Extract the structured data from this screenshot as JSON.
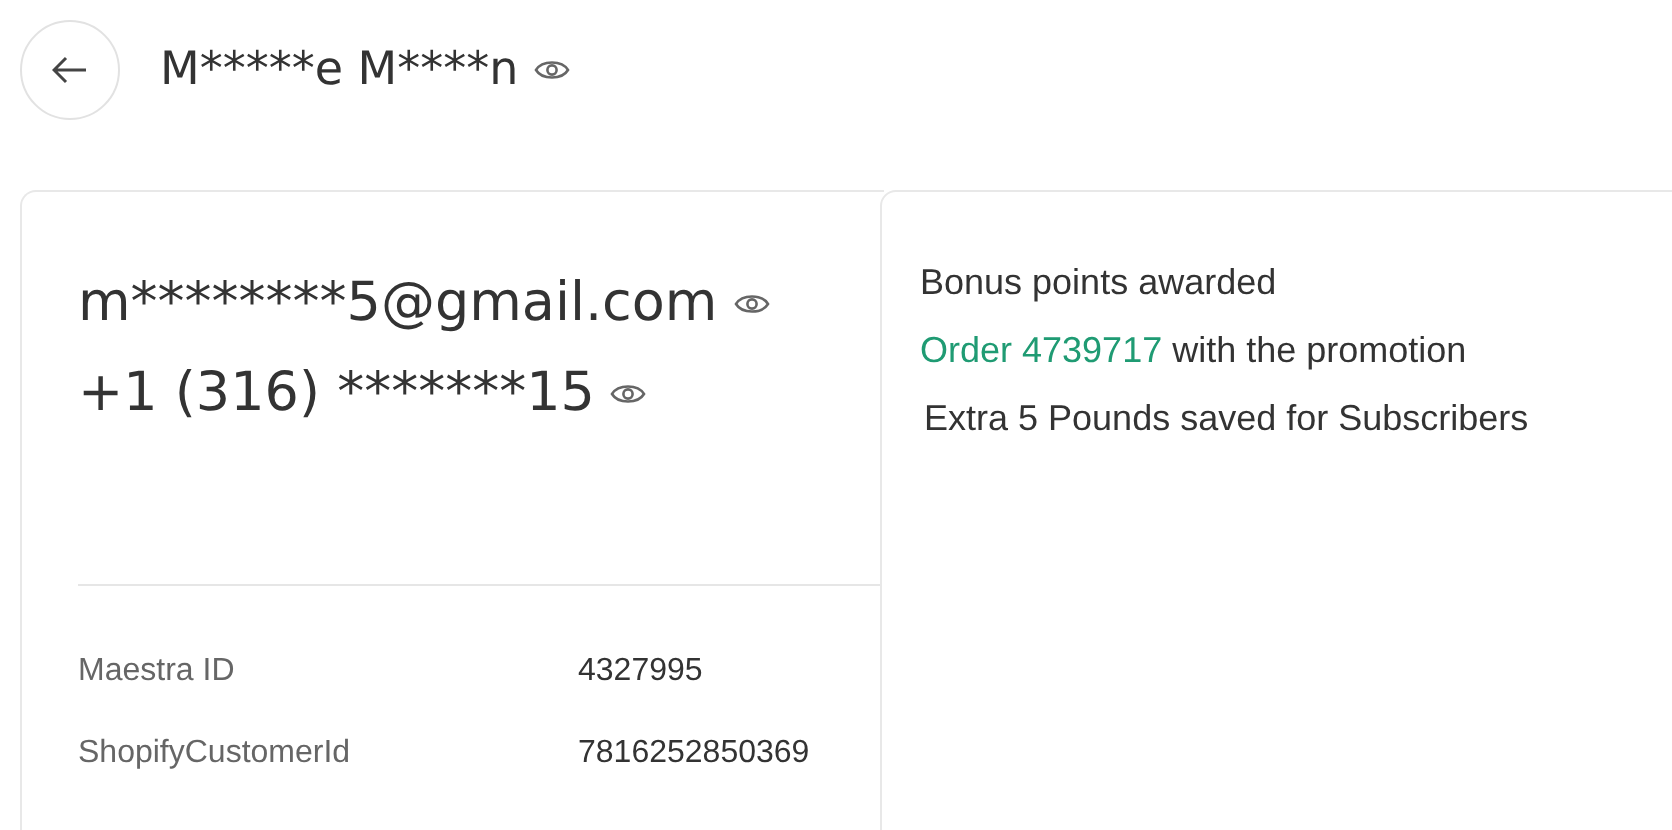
{
  "header": {
    "name": "M*****e M****n"
  },
  "contact": {
    "email": "m********5@gmail.com",
    "phone": "+1 (316) *******15"
  },
  "ids": [
    {
      "label": "Maestra ID",
      "value": "4327995"
    },
    {
      "label": "ShopifyCustomerId",
      "value": "7816252850369"
    }
  ],
  "event": {
    "title": "Bonus points awarded",
    "order_link": "Order 4739717",
    "order_text": "with the promotion",
    "detail": "Extra 5 Pounds saved for Subscribers"
  }
}
